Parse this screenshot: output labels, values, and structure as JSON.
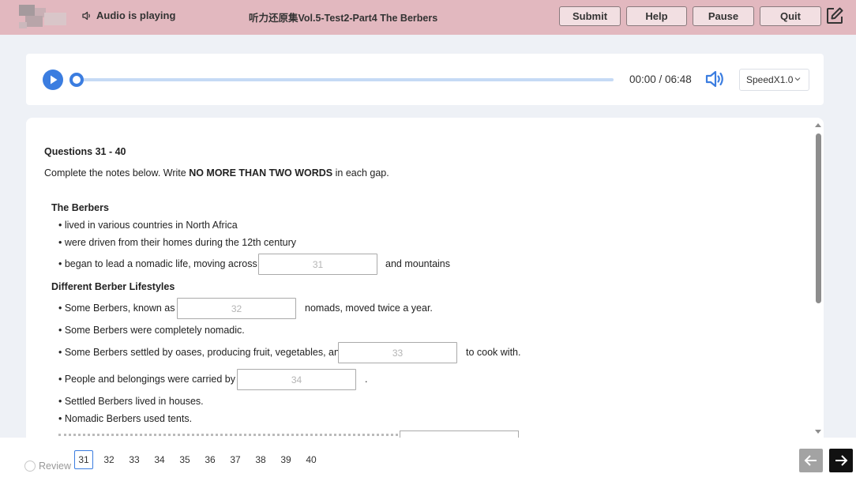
{
  "header": {
    "audio_status": "Audio is playing",
    "title": "听力还原集Vol.5-Test2-Part4 The Berbers",
    "buttons": {
      "submit": "Submit",
      "help": "Help",
      "pause": "Pause",
      "quit": "Quit"
    }
  },
  "player": {
    "time": "00:00 / 06:48",
    "speed": "SpeedX1.0",
    "progress": 0
  },
  "content": {
    "questions_heading": "Questions 31 - 40",
    "instruction_before": "Complete the notes below. Write ",
    "instruction_bold": "NO MORE THAN TWO WORDS",
    "instruction_after": " in each gap.",
    "sections": [
      {
        "title": "The Berbers"
      },
      {
        "title": "Different Berber Lifestyles"
      }
    ],
    "lines": [
      "• lived in various countries in North Africa",
      "• were driven from their homes during the 12th century",
      "• began to lead a nomadic life, moving across",
      "and mountains",
      "• Some Berbers, known as",
      "nomads, moved twice a year.",
      "• Some Berbers were completely nomadic.",
      "• Some Berbers settled by oases, producing fruit, vegetables, and",
      "to cook with.",
      "• People and belongings were carried by",
      ".",
      "• Settled Berbers lived in houses.",
      "• Nomadic Berbers used tents."
    ],
    "gaps": [
      {
        "placeholder": "31"
      },
      {
        "placeholder": "32"
      },
      {
        "placeholder": "33"
      },
      {
        "placeholder": "34"
      }
    ]
  },
  "footer": {
    "review_label": "Review",
    "question_numbers": [
      "31",
      "32",
      "33",
      "34",
      "35",
      "36",
      "37",
      "38",
      "39",
      "40"
    ],
    "current": "31"
  },
  "colors": {
    "header_bg": "#e2b8bf",
    "accent": "#3b7de0",
    "page_bg": "#eef1f6"
  }
}
